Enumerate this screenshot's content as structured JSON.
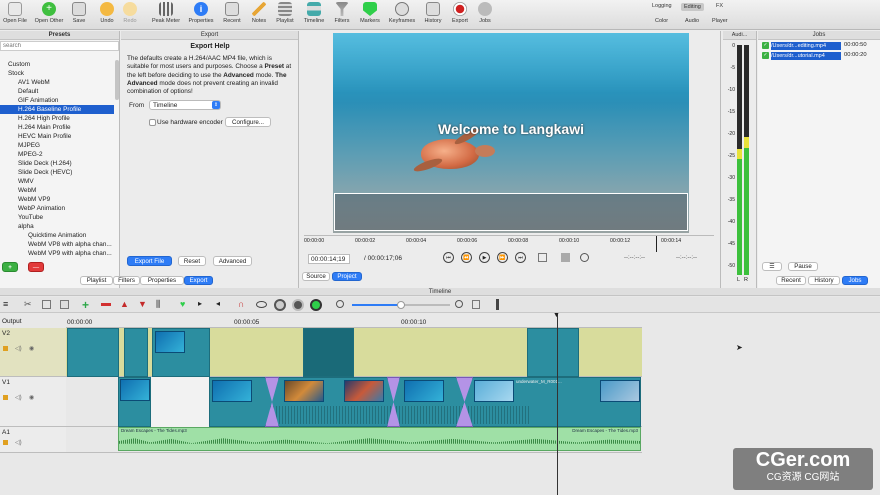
{
  "toolbar": {
    "buttons": [
      {
        "label": "Open File",
        "icon": "folder-icon"
      },
      {
        "label": "Open Other",
        "icon": "plus-circle-icon"
      },
      {
        "label": "Save",
        "icon": "save-icon"
      },
      {
        "label": "Undo",
        "icon": "undo-icon"
      },
      {
        "label": "Redo",
        "icon": "redo-icon"
      },
      {
        "label": "Peak Meter",
        "icon": "peak-meter-icon"
      },
      {
        "label": "Properties",
        "icon": "info-icon"
      },
      {
        "label": "Recent",
        "icon": "recent-icon"
      },
      {
        "label": "Notes",
        "icon": "pencil-icon"
      },
      {
        "label": "Playlist",
        "icon": "playlist-icon"
      },
      {
        "label": "Timeline",
        "icon": "timeline-icon"
      },
      {
        "label": "Filters",
        "icon": "filter-icon"
      },
      {
        "label": "Markers",
        "icon": "marker-icon"
      },
      {
        "label": "Keyframes",
        "icon": "keyframes-icon"
      },
      {
        "label": "History",
        "icon": "history-icon"
      },
      {
        "label": "Export",
        "icon": "export-icon"
      },
      {
        "label": "Jobs",
        "icon": "jobs-icon"
      }
    ],
    "layouts_top": [
      "Logging",
      "Editing",
      "FX"
    ],
    "layouts_bottom": [
      "Color",
      "Audio",
      "Player"
    ],
    "active_layout": "Editing"
  },
  "presets": {
    "title": "Presets",
    "search_placeholder": "search",
    "items": [
      {
        "label": "Custom",
        "level": 0
      },
      {
        "label": "Stock",
        "level": 0
      },
      {
        "label": "AV1 WebM",
        "level": 1
      },
      {
        "label": "Default",
        "level": 1
      },
      {
        "label": "GIF Animation",
        "level": 1
      },
      {
        "label": "H.264 Baseline Profile",
        "level": 1,
        "selected": true
      },
      {
        "label": "H.264 High Profile",
        "level": 1
      },
      {
        "label": "H.264 Main Profile",
        "level": 1
      },
      {
        "label": "HEVC Main Profile",
        "level": 1
      },
      {
        "label": "MJPEG",
        "level": 1
      },
      {
        "label": "MPEG-2",
        "level": 1
      },
      {
        "label": "Slide Deck (H.264)",
        "level": 1
      },
      {
        "label": "Slide Deck (HEVC)",
        "level": 1
      },
      {
        "label": "WMV",
        "level": 1
      },
      {
        "label": "WebM",
        "level": 1
      },
      {
        "label": "WebM VP9",
        "level": 1
      },
      {
        "label": "WebP Animation",
        "level": 1
      },
      {
        "label": "YouTube",
        "level": 1
      },
      {
        "label": "alpha",
        "level": 1
      },
      {
        "label": "Quicktime Animation",
        "level": 2
      },
      {
        "label": "WebM VP8 with alpha chan...",
        "level": 2
      },
      {
        "label": "WebM VP9 with alpha chan...",
        "level": 2
      }
    ],
    "add_label": "+",
    "remove_label": "—"
  },
  "export": {
    "panel_title": "Export",
    "help_title": "Export Help",
    "help_text_1": "The defaults create a H.264/AAC MP4 file, which is suitable for most users and purposes. Choose a ",
    "help_bold_1": "Preset",
    "help_text_2": " at the left before deciding to use the ",
    "help_bold_2": "Advanced",
    "help_text_3": " mode.",
    "help_bold_3": "The Advanced",
    "help_text_4": " mode does not prevent creating an invalid combination of options!",
    "from_label": "From",
    "from_value": "Timeline",
    "hw_encoder_label": "Use hardware encoder",
    "configure_label": "Configure...",
    "export_file_label": "Export File",
    "reset_label": "Reset",
    "advanced_label": "Advanced"
  },
  "left_tabs": [
    "Playlist",
    "Filters",
    "Properties",
    "Export"
  ],
  "left_tab_active": "Export",
  "player": {
    "overlay_text": "Welcome to Langkawi",
    "ruler": [
      "00:00:00",
      "00:00:02",
      "00:00:04",
      "00:00:06",
      "00:00:08",
      "00:00:10",
      "00:00:12",
      "00:00:14"
    ],
    "position": "00:00:14;19",
    "duration": "/ 00:00:17;06",
    "in_point": "--:--:--:--",
    "out_point": "--:--:--:--",
    "tabs": [
      "Source",
      "Project"
    ],
    "active_tab": "Project"
  },
  "audio_meter": {
    "title": "Audi...",
    "scale": [
      "0",
      "-5",
      "-10",
      "-15",
      "-20",
      "-25",
      "-30",
      "-35",
      "-40",
      "-45",
      "-50"
    ],
    "channels": [
      "L",
      "R"
    ],
    "level_left": 0.55,
    "level_right": 0.6
  },
  "jobs": {
    "title": "Jobs",
    "items": [
      {
        "name": "/Users/dr...editing.mp4",
        "time": "00:00:50"
      },
      {
        "name": "/Users/dr...utorial.mp4",
        "time": "00:00:20"
      }
    ],
    "menu_label": "☰",
    "pause_label": "Pause",
    "tabs": [
      "Recent",
      "History",
      "Jobs"
    ],
    "active_tab": "Jobs"
  },
  "timeline": {
    "title": "Timeline",
    "output_label": "Output",
    "ruler": [
      "00:00:00",
      "00:00:05",
      "00:00:10"
    ],
    "tracks": [
      "V2",
      "V1",
      "A1"
    ],
    "audio_clip_name": "Dream Escapes - The Tides.mp3",
    "clip_name": "underwater_M_R001...",
    "zoom_level": 0.5
  },
  "watermark": {
    "main": "CGer.com",
    "sub": "CG资源 CG网站"
  },
  "colors": {
    "accent": "#2e7cf6",
    "selection": "#1e5fce",
    "clip": "#2c8ea0",
    "transition": "#b493e6",
    "track_v2": "#d8dc9c"
  }
}
